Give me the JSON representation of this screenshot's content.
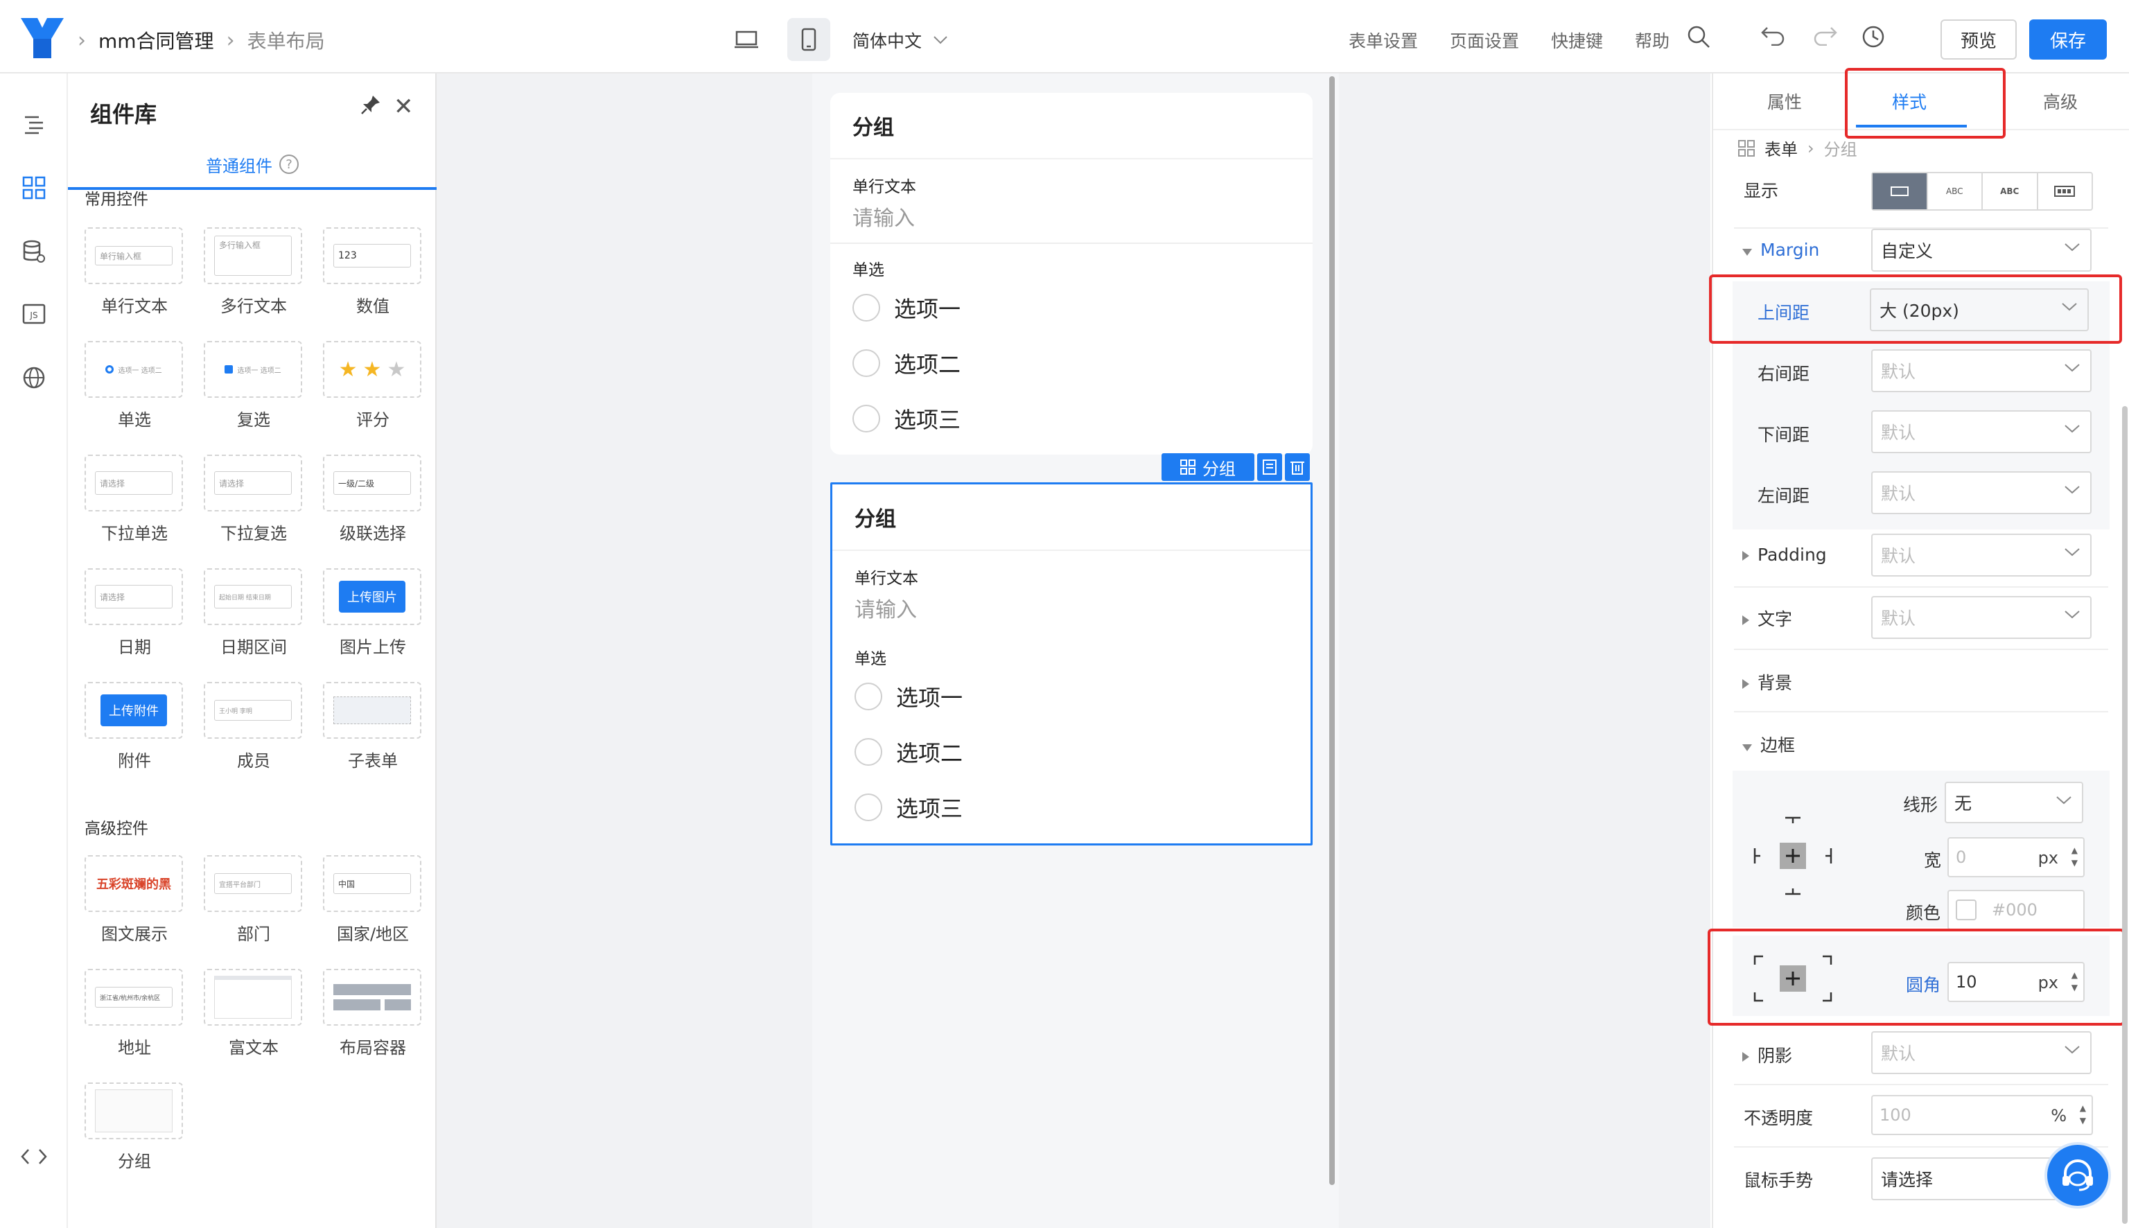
{
  "header": {
    "breadcrumb_app": "mm合同管理",
    "breadcrumb_page": "表单布局",
    "language": "简体中文",
    "links": [
      "表单设置",
      "页面设置",
      "快捷键",
      "帮助"
    ],
    "preview_label": "预览",
    "save_label": "保存"
  },
  "library": {
    "title": "组件库",
    "tab": "普通组件",
    "common_title": "常用控件",
    "advanced_title": "高级控件",
    "common": [
      {
        "label": "单行文本",
        "preview": "单行输入框"
      },
      {
        "label": "多行文本",
        "preview": "多行输入框"
      },
      {
        "label": "数值",
        "preview": "123"
      },
      {
        "label": "单选",
        "preview": "选项一  选项二"
      },
      {
        "label": "复选",
        "preview": "选项一  选项二"
      },
      {
        "label": "评分",
        "preview": ""
      },
      {
        "label": "下拉单选",
        "preview": "请选择"
      },
      {
        "label": "下拉复选",
        "preview": "请选择"
      },
      {
        "label": "级联选择",
        "preview": "一级/二级"
      },
      {
        "label": "日期",
        "preview": "请选择"
      },
      {
        "label": "日期区间",
        "preview": "起始日期  结束日期"
      },
      {
        "label": "图片上传",
        "preview": "上传图片"
      },
      {
        "label": "附件",
        "preview": "上传附件"
      },
      {
        "label": "成员",
        "preview": "王小明  李明"
      },
      {
        "label": "子表单",
        "preview": ""
      }
    ],
    "advanced": [
      {
        "label": "图文展示",
        "preview": "五彩斑斓的黑"
      },
      {
        "label": "部门",
        "preview": "宜搭平台部门"
      },
      {
        "label": "国家/地区",
        "preview": "中国"
      },
      {
        "label": "地址",
        "preview": "浙江省/杭州市/余杭区"
      },
      {
        "label": "富文本",
        "preview": ""
      },
      {
        "label": "布局容器",
        "preview": ""
      },
      {
        "label": "分组",
        "preview": ""
      }
    ]
  },
  "canvas": {
    "groups": [
      {
        "title": "分组",
        "text_label": "单行文本",
        "text_placeholder": "请输入",
        "radio_label": "单选",
        "options": [
          "选项一",
          "选项二",
          "选项三"
        ]
      },
      {
        "title": "分组",
        "text_label": "单行文本",
        "text_placeholder": "请输入",
        "radio_label": "单选",
        "options": [
          "选项一",
          "选项二",
          "选项三"
        ]
      }
    ],
    "selected_tag": "分组"
  },
  "panel": {
    "tabs": [
      "属性",
      "样式",
      "高级"
    ],
    "active_tab": "样式",
    "crumb_root": "表单",
    "crumb_current": "分组",
    "display_label": "显示",
    "display_options": [
      "",
      "ABC",
      "ABC",
      ""
    ],
    "margin_label": "Margin",
    "margin_value": "自定义",
    "margin_top_label": "上间距",
    "margin_top_value": "大 (20px)",
    "margin_right_label": "右间距",
    "margin_bottom_label": "下间距",
    "margin_left_label": "左间距",
    "default_ph": "默认",
    "padding_label": "Padding",
    "text_label": "文字",
    "bg_label": "背景",
    "border_label": "边框",
    "line_label": "线形",
    "line_value": "无",
    "width_label": "宽",
    "width_ph": "0",
    "unit_px": "px",
    "color_label": "颜色",
    "color_ph": "#000",
    "radius_label": "圆角",
    "radius_value": "10",
    "shadow_label": "阴影",
    "opacity_label": "不透明度",
    "opacity_ph": "100",
    "opacity_unit": "%",
    "cursor_label": "鼠标手势",
    "cursor_value": "请选择"
  },
  "colors": {
    "accent": "#1e7cf2",
    "highlight": "#e62a2a",
    "canvas_bg": "#f1f2f4"
  }
}
